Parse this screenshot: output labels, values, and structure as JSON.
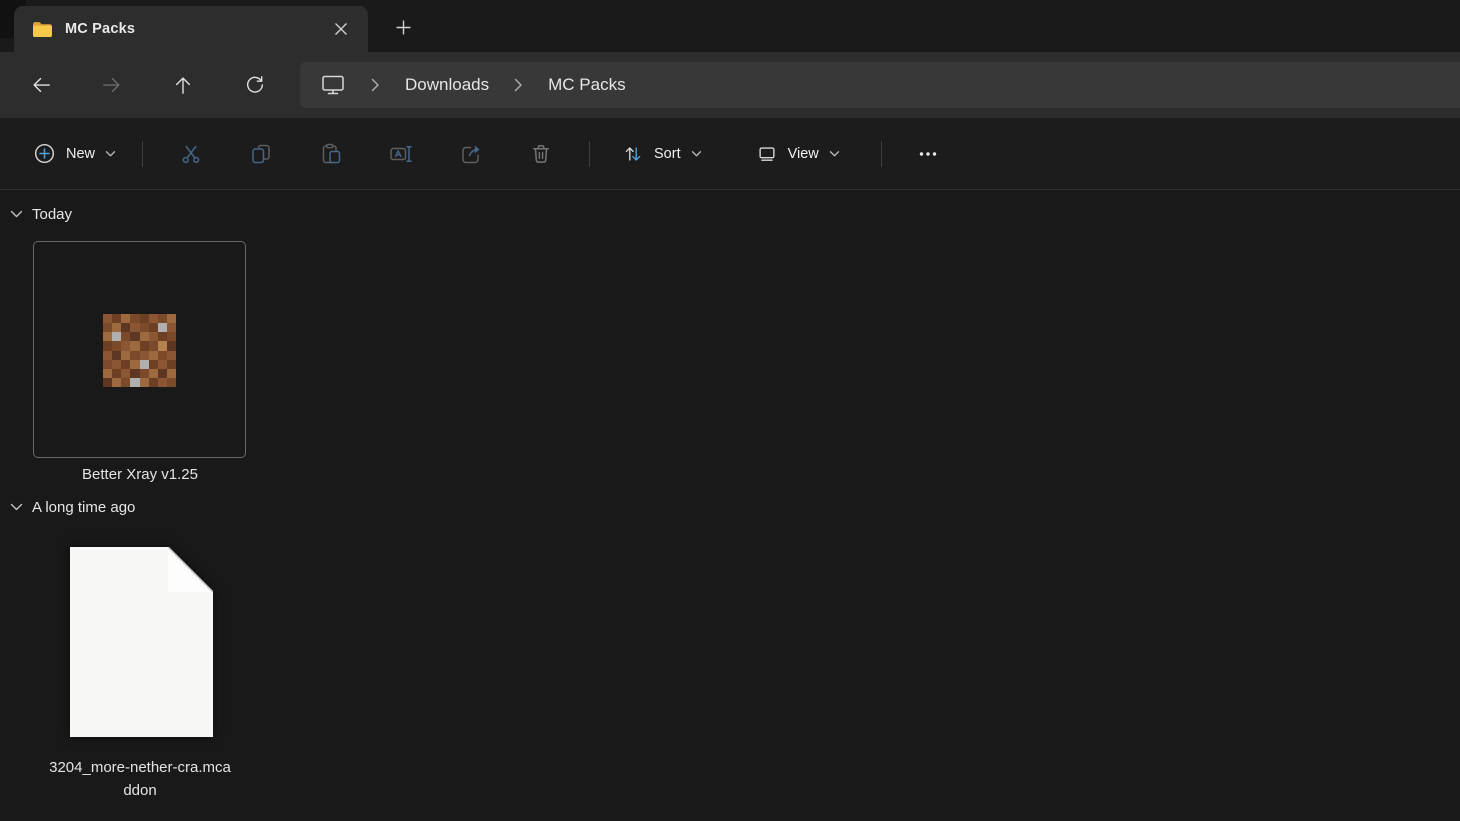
{
  "colors": {
    "accent_blue": "#4da0dd",
    "steel_blue_icon": "#44678a",
    "folder_yellow": "#f3c14d",
    "window_background": "#191919"
  },
  "tab_bar": {
    "active_tab": {
      "title": "MC Packs"
    }
  },
  "navigation": {
    "address": {
      "segments": [
        "Downloads",
        "MC Packs"
      ]
    }
  },
  "toolbar": {
    "new_label": "New",
    "sort_label": "Sort",
    "view_label": "View",
    "icon_buttons": [
      "cut",
      "copy",
      "paste",
      "rename",
      "share",
      "delete",
      "more-options"
    ]
  },
  "content": {
    "groups": [
      {
        "label": "Today",
        "items": [
          {
            "name": "Better Xray v1.25",
            "thumbnail": "minecraft-dirt-texture",
            "pixels": [
              [
                "#8a5633",
                "#6e4023",
                "#9c6a3e",
                "#7a4a2a",
                "#6e4023",
                "#8a5633",
                "#7a4a2a",
                "#9c6a3e"
              ],
              [
                "#7a4a2a",
                "#9c6a3e",
                "#5d3721",
                "#8a5633",
                "#7a4a2a",
                "#6e4023",
                "#b0b0b0",
                "#8a5633"
              ],
              [
                "#9c6a3e",
                "#b0b0b0",
                "#7a4a2a",
                "#5d3721",
                "#9c6a3e",
                "#8a5633",
                "#6e4023",
                "#7a4a2a"
              ],
              [
                "#6e4023",
                "#7a4a2a",
                "#8a5633",
                "#9c6a3e",
                "#6e4023",
                "#7a4a2a",
                "#b5824f",
                "#5d3721"
              ],
              [
                "#8a5633",
                "#5d3721",
                "#9c6a3e",
                "#7a4a2a",
                "#8a5633",
                "#9c6a3e",
                "#7a4a2a",
                "#8a5633"
              ],
              [
                "#7a4a2a",
                "#8a5633",
                "#6e4023",
                "#9c6a3e",
                "#b0b0b0",
                "#6e4023",
                "#8a5633",
                "#6e4023"
              ],
              [
                "#9c6a3e",
                "#6e4023",
                "#8a5633",
                "#5d3721",
                "#7a4a2a",
                "#9c6a3e",
                "#5d3721",
                "#9c6a3e"
              ],
              [
                "#5d3721",
                "#9c6a3e",
                "#7a4a2a",
                "#b0b0b0",
                "#9c6a3e",
                "#6e4023",
                "#8a5633",
                "#7a4a2a"
              ]
            ]
          }
        ]
      },
      {
        "label": "A long time ago",
        "items": [
          {
            "name": "3204_more-nether-cra.mcaddon",
            "thumbnail": "blank-document"
          }
        ]
      }
    ]
  }
}
